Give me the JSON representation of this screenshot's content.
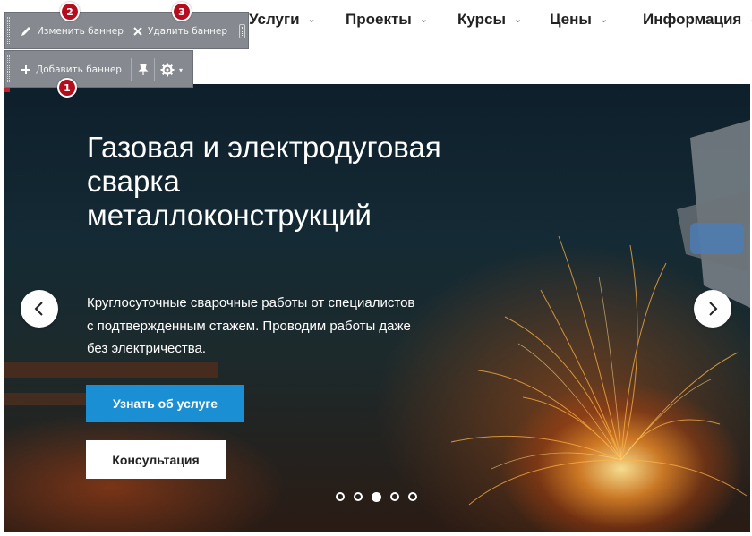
{
  "nav": {
    "items": [
      {
        "label": "Услуги"
      },
      {
        "label": "Проекты"
      },
      {
        "label": "Курсы"
      },
      {
        "label": "Цены"
      },
      {
        "label": "Информация"
      }
    ]
  },
  "toolbar": {
    "edit_label": "Изменить баннер",
    "delete_label": "Удалить баннер",
    "add_label": "Добавить баннер",
    "icons": [
      "pencil-icon",
      "close-icon",
      "plus-icon",
      "pin-icon",
      "gear-icon"
    ]
  },
  "badges": {
    "one": "1",
    "two": "2",
    "three": "3"
  },
  "banner": {
    "title": "Газовая и электродуговая сварка металлоконструкций",
    "subtitle": "Круглосуточные сварочные работы от специалистов с подтвержденным стажем. Проводим работы даже без электричества.",
    "primary_button": "Узнать об услуге",
    "secondary_button": "Консультация",
    "slides_total": 5,
    "active_slide": 3
  },
  "colors": {
    "accent": "#1a8fd4",
    "badge": "#b50d1d",
    "toolbar": "#868a90"
  }
}
